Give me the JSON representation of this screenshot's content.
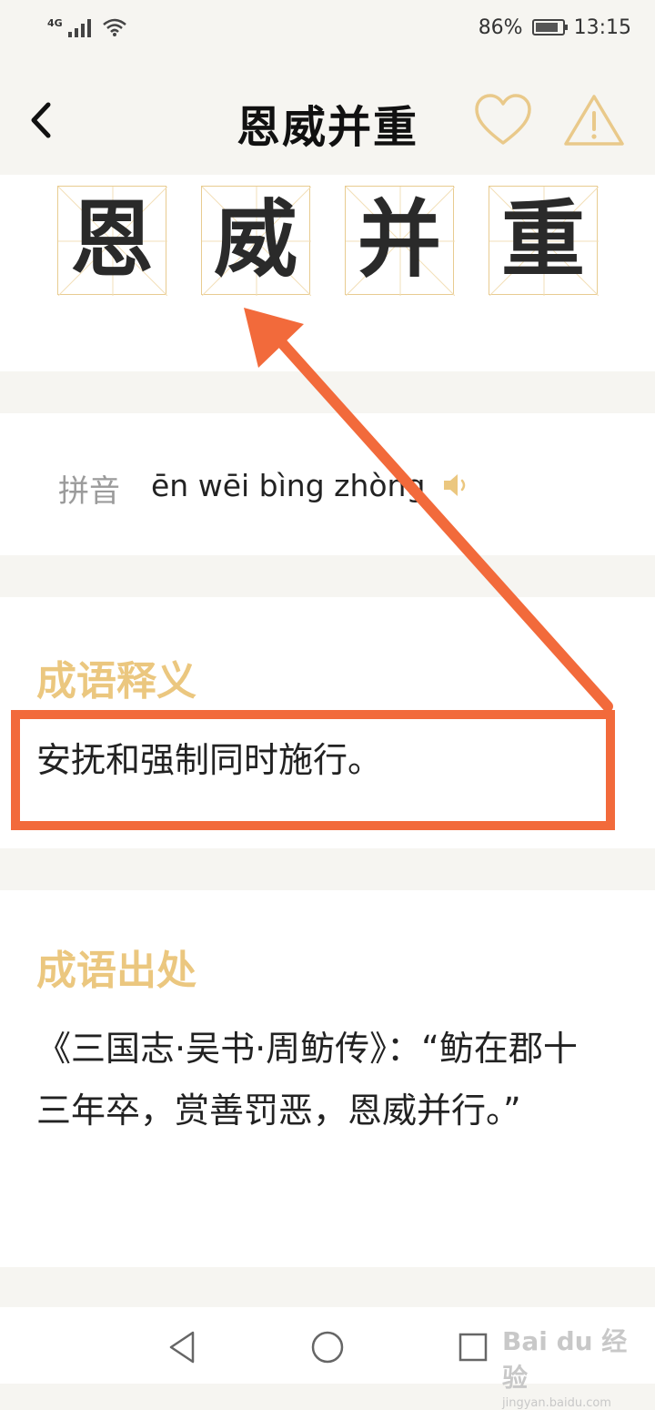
{
  "status_bar": {
    "network": "4G",
    "battery": "86%",
    "battery_level": 0.86,
    "time": "13:15"
  },
  "header": {
    "title": "恩威并重",
    "back_icon": "chevron-left-icon",
    "favorite_icon": "heart-outline-icon",
    "report_icon": "warning-triangle-icon"
  },
  "characters": [
    "恩",
    "威",
    "并",
    "重"
  ],
  "pinyin": {
    "label": "拼音",
    "text": "ēn wēi bìng zhòng",
    "speaker_icon": "speaker-icon"
  },
  "meaning": {
    "title": "成语释义",
    "text": "安抚和强制同时施行。"
  },
  "origin": {
    "title": "成语出处",
    "text": "《三国志·吴书·周鲂传》：“鲂在郡十三年卒，赏善罚恶，恩威并行。”"
  },
  "nav_bar": {
    "back_icon": "triangle-back-icon",
    "home_icon": "circle-home-icon",
    "recents_icon": "square-recents-icon"
  },
  "watermark": {
    "main": "Bai du 经验",
    "sub": "jingyan.baidu.com"
  },
  "colors": {
    "accent_gold": "#ebc77f",
    "grid_border": "#e8cc91",
    "annotation_orange": "#f26a3b",
    "background": "#f6f5f1"
  }
}
